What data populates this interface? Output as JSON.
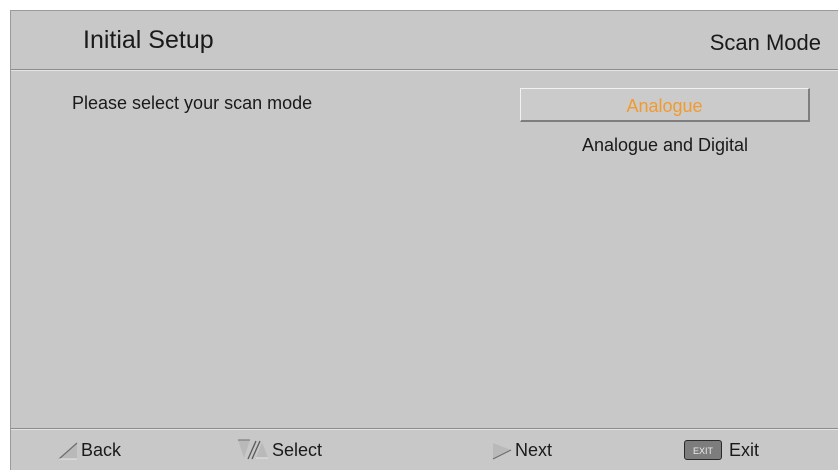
{
  "header": {
    "title": "Initial Setup",
    "page_name": "Scan Mode"
  },
  "main": {
    "prompt": "Please select your scan mode",
    "options": [
      {
        "label": "Analogue",
        "selected": true
      },
      {
        "label": "Analogue and Digital",
        "selected": false
      }
    ]
  },
  "footer": {
    "back": {
      "label": "Back",
      "icon": "left-arrow-icon"
    },
    "select": {
      "label": "Select",
      "icon": "up-down-arrow-icon"
    },
    "next": {
      "label": "Next",
      "icon": "right-arrow-icon"
    },
    "exit": {
      "label": "Exit",
      "badge": "EXIT",
      "icon": "exit-key-icon"
    }
  },
  "colors": {
    "background": "#c8c8c8",
    "selected_text": "#f29a2e",
    "text": "#1a1a1a"
  }
}
